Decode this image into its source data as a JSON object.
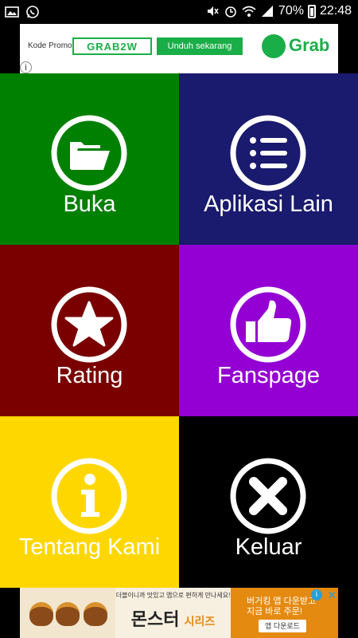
{
  "status_bar": {
    "battery": "70%",
    "time": "22:48",
    "notification_icons": [
      "image-icon",
      "whatsapp-icon"
    ],
    "system_icons": [
      "mute-icon",
      "alarm-icon",
      "wifi-icon",
      "signal-icon",
      "battery-icon"
    ]
  },
  "ad_top": {
    "promo_label": "Kode Promo",
    "promo_code": "GRAB2W",
    "download_button": "Unduh sekarang",
    "brand": "Grab",
    "info_glyph": "i",
    "brand_color": "#1aae48"
  },
  "menu": {
    "tiles": [
      {
        "label": "Buka",
        "color": "#008000",
        "icon": "folder-icon"
      },
      {
        "label": "Aplikasi Lain",
        "color": "#1a1a6e",
        "icon": "list-icon"
      },
      {
        "label": "Rating",
        "color": "#7a0000",
        "icon": "star-icon"
      },
      {
        "label": "Fanspage",
        "color": "#9400d3",
        "icon": "thumbs-up-icon"
      },
      {
        "label": "Tentang Kami",
        "color": "#ffd700",
        "icon": "info-icon"
      },
      {
        "label": "Keluar",
        "color": "#000000",
        "icon": "close-icon"
      }
    ]
  },
  "ad_bottom": {
    "title": "몬스터",
    "title_suffix": "시리즈",
    "small_text": "더블이니까 맛있고 앱으로 편하게 만나세요!",
    "right_line1": "버거킹 앱 다운받고",
    "right_line2": "지금 바로 주문!",
    "button": "앱 다운로드",
    "info_glyph": "i",
    "close_glyph": "✕"
  }
}
